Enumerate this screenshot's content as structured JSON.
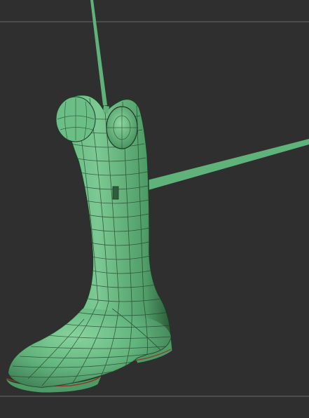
{
  "viewport": {
    "background_color": "#2f2f2f",
    "frame_line_color": "#6a6a6a",
    "model": {
      "name": "boot-mesh",
      "base_color": "#5fb37a",
      "shadow_color": "#2f5e3c",
      "highlight_color": "#8fd8a2",
      "wire_color": "#1f3a27",
      "sole_color": "#4e9965",
      "sole_edge_color": "#8a3a2a"
    },
    "gizmo": {
      "vertical_axis_color": "#5fb37a",
      "horizontal_axis_color": "#5fb37a"
    }
  }
}
